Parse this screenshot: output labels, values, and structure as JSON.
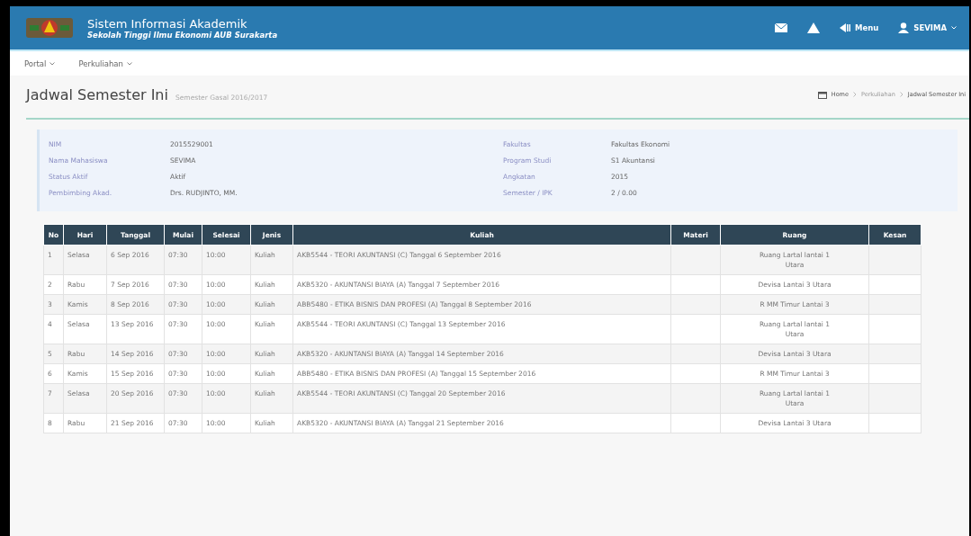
{
  "header": {
    "title": "Sistem Informasi Akademik",
    "subtitle": "Sekolah Tinggi Ilmu Ekonomi AUB Surakarta",
    "menu_label": "Menu",
    "user": "SEVIMA"
  },
  "nav": [
    {
      "label": "Portal"
    },
    {
      "label": "Perkuliahan"
    }
  ],
  "page": {
    "title": "Jadwal Semester Ini",
    "subtitle": "Semester Gasal 2016/2017"
  },
  "breadcrumb": [
    "Home",
    "Perkuliahan",
    "Jadwal Semester Ini"
  ],
  "info_left": [
    {
      "label": "NIM",
      "value": "2015529001"
    },
    {
      "label": "Nama Mahasiswa",
      "value": "SEVIMA"
    },
    {
      "label": "Status Aktif",
      "value": "Aktif"
    },
    {
      "label": "Pembimbing Akad.",
      "value": "Drs. RUDJINTO, MM."
    }
  ],
  "info_right": [
    {
      "label": "Fakultas",
      "value": "Fakultas Ekonomi"
    },
    {
      "label": "Program Studi",
      "value": "S1 Akuntansi"
    },
    {
      "label": "Angkatan",
      "value": "2015"
    },
    {
      "label": "Semester / IPK",
      "value": "2 / 0.00"
    }
  ],
  "table": {
    "columns": [
      "No",
      "Hari",
      "Tanggal",
      "Mulai",
      "Selesai",
      "Jenis",
      "Kuliah",
      "Materi",
      "Ruang",
      "Kesan"
    ],
    "rows": [
      [
        "1",
        "Selasa",
        "6 Sep 2016",
        "07:30",
        "10:00",
        "Kuliah",
        "AKB5544 - TEORI AKUNTANSI (C) Tanggal 6 September 2016",
        "",
        "Ruang Lartal lantai 1 Utara",
        ""
      ],
      [
        "2",
        "Rabu",
        "7 Sep 2016",
        "07:30",
        "10:00",
        "Kuliah",
        "AKB5320 - AKUNTANSI BIAYA (A) Tanggal 7 September 2016",
        "",
        "Devisa Lantai 3 Utara",
        ""
      ],
      [
        "3",
        "Kamis",
        "8 Sep 2016",
        "07:30",
        "10:00",
        "Kuliah",
        "ABB5480 - ETIKA BISNIS DAN PROFESI (A) Tanggal 8 September 2016",
        "",
        "R MM Timur Lantai 3",
        ""
      ],
      [
        "4",
        "Selasa",
        "13 Sep 2016",
        "07:30",
        "10:00",
        "Kuliah",
        "AKB5544 - TEORI AKUNTANSI (C) Tanggal 13 September 2016",
        "",
        "Ruang Lartal lantai 1 Utara",
        ""
      ],
      [
        "5",
        "Rabu",
        "14 Sep 2016",
        "07:30",
        "10:00",
        "Kuliah",
        "AKB5320 - AKUNTANSI BIAYA (A) Tanggal 14 September 2016",
        "",
        "Devisa Lantai 3 Utara",
        ""
      ],
      [
        "6",
        "Kamis",
        "15 Sep 2016",
        "07:30",
        "10:00",
        "Kuliah",
        "ABB5480 - ETIKA BISNIS DAN PROFESI (A) Tanggal 15 September 2016",
        "",
        "R MM Timur Lantai 3",
        ""
      ],
      [
        "7",
        "Selasa",
        "20 Sep 2016",
        "07:30",
        "10:00",
        "Kuliah",
        "AKB5544 - TEORI AKUNTANSI (C) Tanggal 20 September 2016",
        "",
        "Ruang Lartal lantai 1 Utara",
        ""
      ],
      [
        "8",
        "Rabu",
        "21 Sep 2016",
        "07:30",
        "10:00",
        "Kuliah",
        "AKB5320 - AKUNTANSI BIAYA (A) Tanggal 21 September 2016",
        "",
        "Devisa Lantai 3 Utara",
        ""
      ]
    ]
  }
}
